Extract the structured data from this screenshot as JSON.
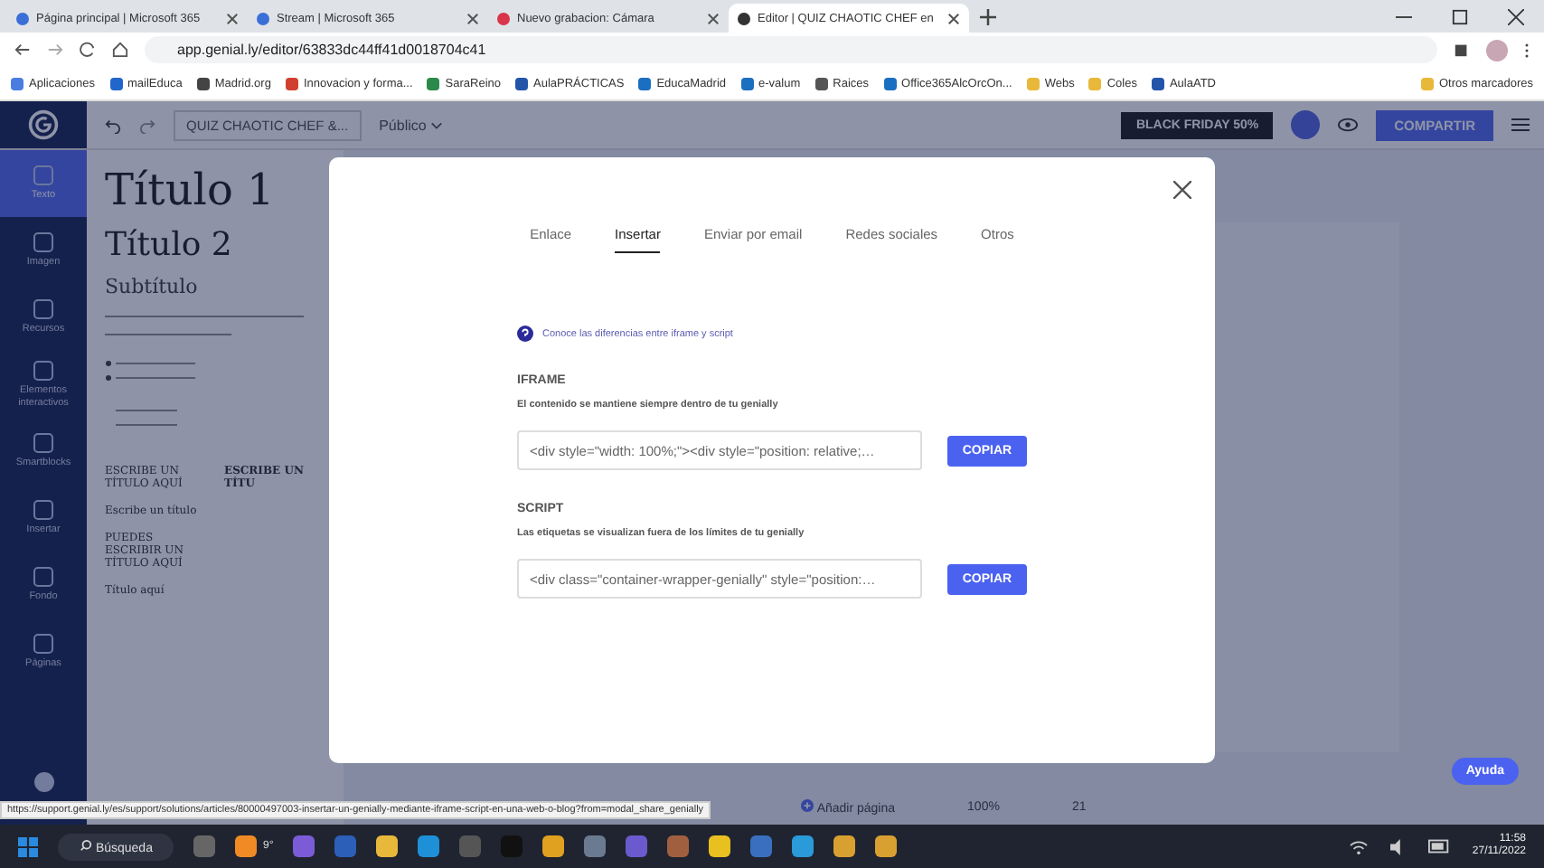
{
  "browser": {
    "tabs": [
      {
        "title": "Página principal | Microsoft 365",
        "selected": false
      },
      {
        "title": "Stream | Microsoft 365",
        "selected": false
      },
      {
        "title": "Nuevo grabacion: Cámara",
        "selected": false
      },
      {
        "title": "Editor | QUIZ CHAOTIC CHEF en",
        "selected": true
      }
    ],
    "url": "app.genial.ly/editor/63833dc44ff41d0018704c41",
    "bookmarks": [
      "Aplicaciones",
      "mailEduca",
      "Madrid.org",
      "Innovacion y forma...",
      "SaraReino",
      "AulaPRÁCTICAS",
      "EducaMadrid",
      "e-valum",
      "Raices",
      "Office365AlcOrcOn...",
      "Webs",
      "Coles",
      "AulaATD"
    ],
    "other_bookmarks": "Otros marcadores"
  },
  "editor": {
    "title": "QUIZ CHAOTIC CHEF &...",
    "visibility": "Público",
    "promo": "BLACK FRIDAY 50%",
    "share": "COMPARTIR"
  },
  "sidebar": [
    {
      "label": "Texto",
      "selected": true
    },
    {
      "label": "Imagen",
      "selected": false
    },
    {
      "label": "Recursos",
      "selected": false
    },
    {
      "label": "Elementos interactivos",
      "selected": false
    },
    {
      "label": "Smartblocks",
      "selected": false
    },
    {
      "label": "Insertar",
      "selected": false
    },
    {
      "label": "Fondo",
      "selected": false
    },
    {
      "label": "Páginas",
      "selected": false
    }
  ],
  "text_panel": {
    "headings": [
      "Título 1",
      "Título 2",
      "Subtítulo"
    ],
    "styles_left": [
      "ESCRIBE UN TÍTULO AQUÍ",
      "Escribe un título",
      "PUEDES ESCRIBIR UN TÍTULO AQUÍ",
      "Título aquí"
    ],
    "styles_right": [
      "ESCRIBE UN TÍTU"
    ]
  },
  "toolbar": {
    "add_page": "Añadir página",
    "zoom": "100%",
    "page": "21",
    "help": "Ayuda"
  },
  "modal": {
    "tabs": [
      {
        "label": "Enlace",
        "selected": false
      },
      {
        "label": "Insertar",
        "selected": true
      },
      {
        "label": "Enviar por email",
        "selected": false
      },
      {
        "label": "Redes sociales",
        "selected": false
      },
      {
        "label": "Otros",
        "selected": false
      }
    ],
    "info_link": "Conoce las diferencias entre iframe y script",
    "sections": [
      {
        "heading": "IFRAME",
        "description": "El contenido se mantiene siempre dentro de tu genially",
        "code": "<div style=\"width: 100%;\"><div style=\"position: relative;…",
        "button": "COPIAR"
      },
      {
        "heading": "SCRIPT",
        "description": "Las etiquetas se visualizan fuera de los límites de tu genially",
        "code": "<div class=\"container-wrapper-genially\" style=\"position:…",
        "button": "COPIAR"
      }
    ]
  },
  "status_url": "https://support.genial.ly/es/support/solutions/articles/80000497003-insertar-un-genially-mediante-iframe-script-en-una-web-o-blog?from=modal_share_genially",
  "taskbar": {
    "search": "Búsqueda",
    "weather": "9°",
    "time": "11:58",
    "date": "27/11/2022"
  }
}
